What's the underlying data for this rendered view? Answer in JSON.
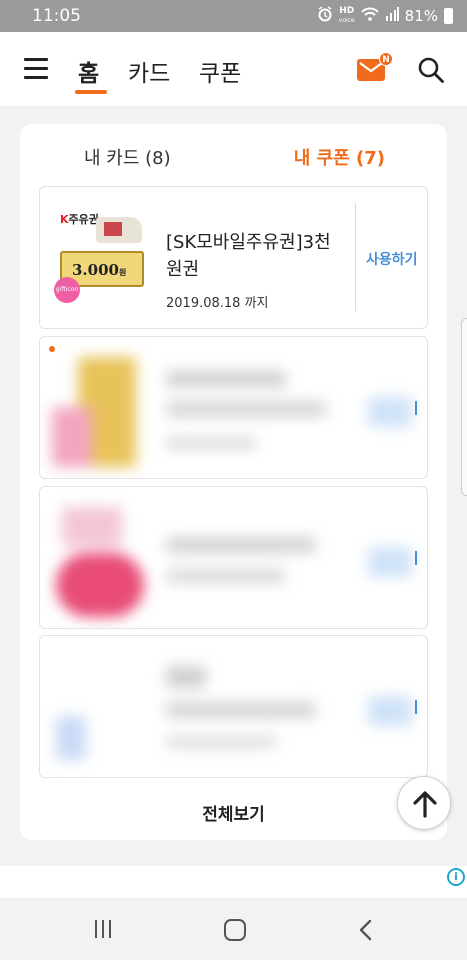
{
  "status_bar": {
    "time": "11:05",
    "battery": "81%",
    "icons": [
      "alarm-icon",
      "hd-voice-icon",
      "wifi-icon",
      "signal-icon",
      "battery-icon"
    ],
    "hd_label_1": "HD",
    "hd_label_2": "voice"
  },
  "nav": {
    "tabs": [
      {
        "label": "홈",
        "active": true
      },
      {
        "label": "카드",
        "active": false
      },
      {
        "label": "쿠폰",
        "active": false
      }
    ],
    "mail_badge": "N",
    "accent_color": "#f06b1c"
  },
  "inner_tabs": {
    "my_cards": "내 카드 (8)",
    "my_coupons": "내 쿠폰 (7)",
    "active": "my_coupons"
  },
  "coupons": [
    {
      "name": "[SK모바일주유권]3천원권",
      "expiry": "2019.08.18 까지",
      "use_label": "사용하기",
      "thumbnail": {
        "brand_k": "K",
        "brand_rest": "주유권",
        "amount": "3.000",
        "amount_unit": "원",
        "badge": "gifticon"
      }
    }
  ],
  "view_all": "전체보기",
  "ad_info": "i"
}
